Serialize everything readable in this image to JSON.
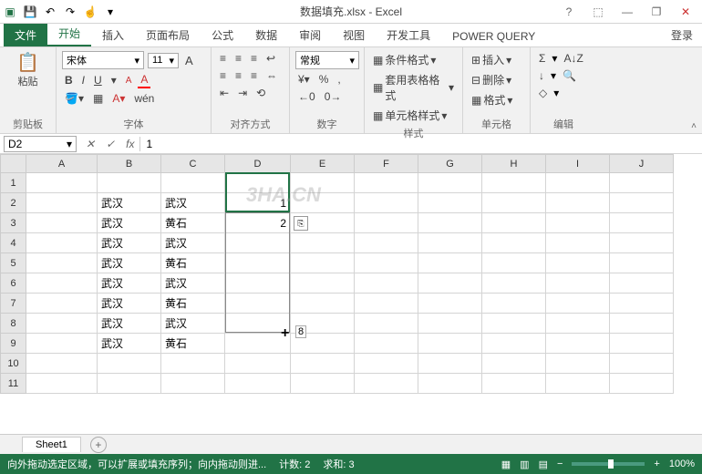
{
  "title": "数据填充.xlsx - Excel",
  "quick_access": {
    "save_icon": "💾",
    "undo_icon": "↶",
    "redo_icon": "↷",
    "touch_icon": "☝"
  },
  "window_controls": {
    "help": "?",
    "ribbon_opts": "⬚",
    "min": "—",
    "max": "❐",
    "close": "✕"
  },
  "tabs": {
    "file": "文件",
    "items": [
      "开始",
      "插入",
      "页面布局",
      "公式",
      "数据",
      "审阅",
      "视图",
      "开发工具",
      "POWER QUERY"
    ],
    "active_index": 0,
    "login": "登录"
  },
  "ribbon": {
    "clipboard": {
      "label": "剪贴板",
      "paste": "粘贴",
      "cut_icon": "✂",
      "copy_icon": "⎘",
      "brush_icon": "🖌"
    },
    "font": {
      "label": "字体",
      "name": "宋体",
      "size": "11",
      "b": "B",
      "i": "I",
      "u": "U",
      "border_icon": "▦",
      "a_grow": "A",
      "a_shrink": "A",
      "wen": "wén"
    },
    "alignment": {
      "label": "对齐方式",
      "wrap_icon": "↩",
      "merge_icon": "⇔"
    },
    "number": {
      "label": "数字",
      "format": "常规",
      "pct": "%",
      "comma": ",",
      "dec_inc": "←0",
      "dec_dec": "0→"
    },
    "styles": {
      "label": "样式",
      "cond": "条件格式",
      "table": "套用表格格式",
      "cell": "单元格样式"
    },
    "cells": {
      "label": "单元格",
      "insert": "插入",
      "delete": "删除",
      "format": "格式"
    },
    "editing": {
      "label": "编辑",
      "sum": "Σ",
      "sort_icon": "A↓Z",
      "fill_icon": "↓",
      "find_icon": "🔍",
      "clear_icon": "◇"
    }
  },
  "namebox": {
    "ref": "D2",
    "expand": "▾"
  },
  "formula_bar": {
    "fx": "fx",
    "check": "✓",
    "cross": "✕",
    "value": "1"
  },
  "columns": [
    "A",
    "B",
    "C",
    "D",
    "E",
    "F",
    "G",
    "H",
    "I",
    "J"
  ],
  "rows": [
    1,
    2,
    3,
    4,
    5,
    6,
    7,
    8,
    9,
    10,
    11
  ],
  "gridData": {
    "2": {
      "B": "武汉",
      "C": "武汉",
      "D": "1"
    },
    "3": {
      "B": "武汉",
      "C": "黄石",
      "D": "2"
    },
    "4": {
      "B": "武汉",
      "C": "武汉"
    },
    "5": {
      "B": "武汉",
      "C": "黄石"
    },
    "6": {
      "B": "武汉",
      "C": "武汉"
    },
    "7": {
      "B": "武汉",
      "C": "黄石"
    },
    "8": {
      "B": "武汉",
      "C": "武汉"
    },
    "9": {
      "B": "武汉",
      "C": "黄石"
    }
  },
  "watermark": "3HA.CN",
  "drag_hint": "8",
  "sheet_tabs": {
    "active": "Sheet1",
    "new_icon": "+"
  },
  "statusbar": {
    "msg": "向外拖动选定区域，可以扩展或填充序列；向内拖动则进...",
    "count_label": "计数:",
    "count": "2",
    "sum_label": "求和:",
    "sum": "3",
    "zoom": "100%"
  }
}
